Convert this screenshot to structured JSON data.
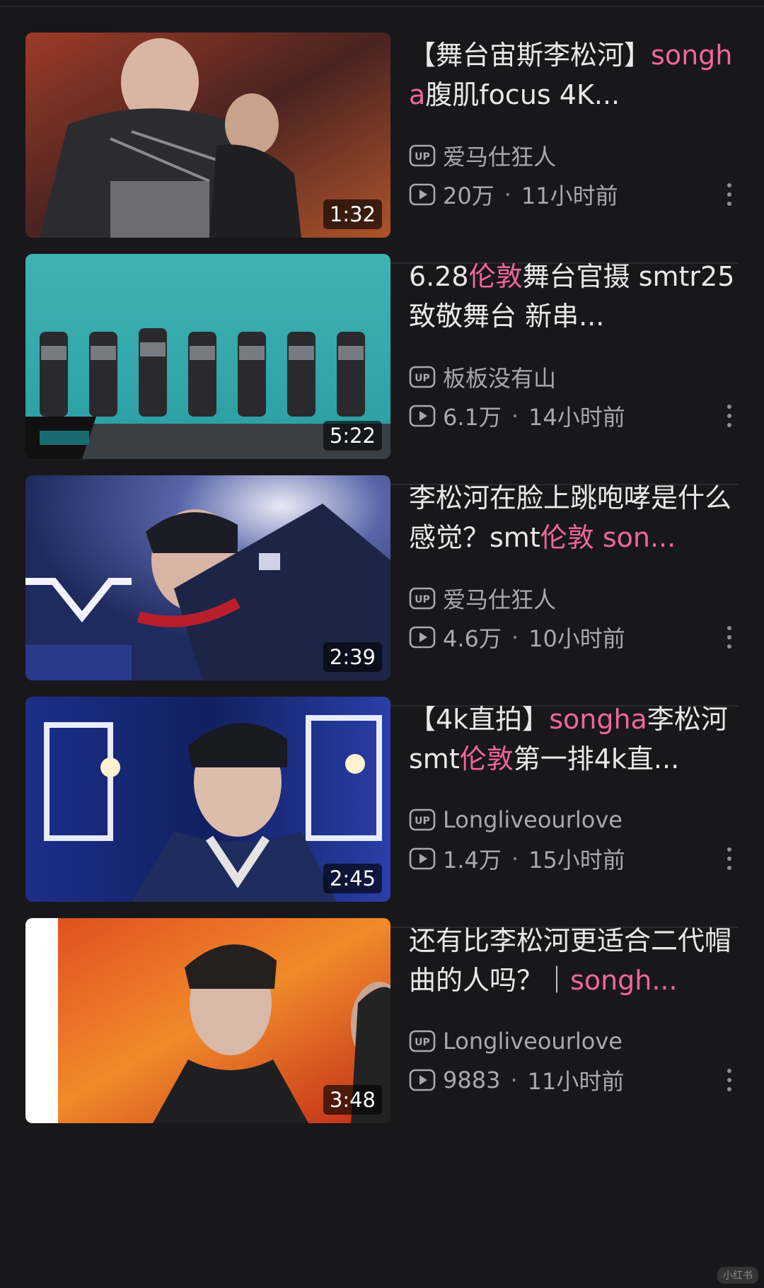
{
  "videos": [
    {
      "duration": "1:32",
      "title_segments": [
        {
          "text": "【舞台宙斯李松河】",
          "highlight": false
        },
        {
          "text": "songha",
          "highlight": true
        },
        {
          "text": "腹肌focus 4K...",
          "highlight": false
        }
      ],
      "uploader": "爱马仕狂人",
      "views": "20万",
      "time": "11小时前"
    },
    {
      "duration": "5:22",
      "title_segments": [
        {
          "text": "6.28",
          "highlight": false
        },
        {
          "text": "伦敦",
          "highlight": true
        },
        {
          "text": "舞台官摄 smtr25 致敬舞台 新串...",
          "highlight": false
        }
      ],
      "uploader": "板板没有山",
      "views": "6.1万",
      "time": "14小时前"
    },
    {
      "duration": "2:39",
      "title_segments": [
        {
          "text": "李松河在脸上跳咆哮是什么感觉？smt",
          "highlight": false
        },
        {
          "text": "伦敦",
          "highlight": true
        },
        {
          "text": " son...",
          "highlight": true
        }
      ],
      "uploader": "爱马仕狂人",
      "views": "4.6万",
      "time": "10小时前"
    },
    {
      "duration": "2:45",
      "title_segments": [
        {
          "text": "【4k直拍】",
          "highlight": false
        },
        {
          "text": "songha",
          "highlight": true
        },
        {
          "text": "李松河smt",
          "highlight": false
        },
        {
          "text": "伦敦",
          "highlight": true
        },
        {
          "text": "第一排4k直...",
          "highlight": false
        }
      ],
      "uploader": "Longliveourlove",
      "views": "1.4万",
      "time": "15小时前"
    },
    {
      "duration": "3:48",
      "title_segments": [
        {
          "text": "还有比李松河更适合二代帽曲的人吗？｜",
          "highlight": false
        },
        {
          "text": "songh...",
          "highlight": true
        }
      ],
      "uploader": "Longliveourlove",
      "views": "9883",
      "time": "11小时前"
    }
  ],
  "meta_separator": "·",
  "colors": {
    "background": "#18181a",
    "highlight": "#f0669b",
    "meta_text": "#a9a9ad"
  },
  "icons": {
    "uploader": "up-badge-icon",
    "views": "play-count-icon",
    "more": "more-vertical-icon"
  },
  "watermark": "小红书"
}
